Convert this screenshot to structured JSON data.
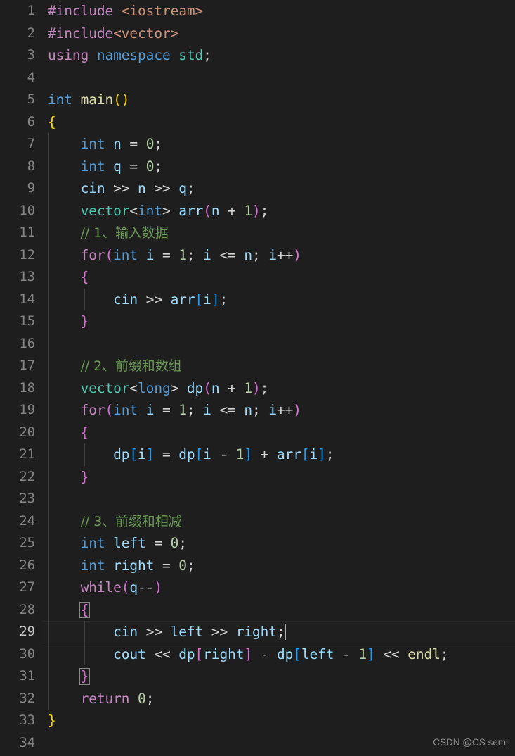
{
  "editor": {
    "language": "cpp",
    "theme": "dark-plus",
    "background_color": "#1e1e1e",
    "gutter_color": "#858585",
    "active_line_number": 29,
    "total_lines": 34,
    "cursor": {
      "line": 29,
      "column": 25
    }
  },
  "watermark": {
    "text": "CSDN @CS semi"
  },
  "line_numbers": [
    "1",
    "2",
    "3",
    "4",
    "5",
    "6",
    "7",
    "8",
    "9",
    "10",
    "11",
    "12",
    "13",
    "14",
    "15",
    "16",
    "17",
    "18",
    "19",
    "20",
    "21",
    "22",
    "23",
    "24",
    "25",
    "26",
    "27",
    "28",
    "29",
    "30",
    "31",
    "32",
    "33",
    "34"
  ],
  "code": {
    "full_text": "#include <iostream>\n#include<vector>\nusing namespace std;\n\nint main()\n{\n    int n = 0;\n    int q = 0;\n    cin >> n >> q;\n    vector<int> arr(n + 1);\n    // 1、输入数据\n    for(int i = 1; i <= n; i++)\n    {\n        cin >> arr[i];\n    }\n\n    // 2、前缀和数组\n    vector<long> dp(n + 1);\n    for(int i = 1; i <= n; i++)\n    {\n        dp[i] = dp[i - 1] + arr[i];\n    }\n\n    // 3、前缀和相减\n    int left = 0;\n    int right = 0;\n    while(q--)\n    {\n        cin >> left >> right;\n        cout << dp[right] - dp[left - 1] << endl;\n    }\n    return 0;\n}\n",
    "lines": [
      {
        "n": "1",
        "text": "#include <iostream>"
      },
      {
        "n": "2",
        "text": "#include<vector>"
      },
      {
        "n": "3",
        "text": "using namespace std;"
      },
      {
        "n": "4",
        "text": ""
      },
      {
        "n": "5",
        "text": "int main()"
      },
      {
        "n": "6",
        "text": "{"
      },
      {
        "n": "7",
        "text": "    int n = 0;"
      },
      {
        "n": "8",
        "text": "    int q = 0;"
      },
      {
        "n": "9",
        "text": "    cin >> n >> q;"
      },
      {
        "n": "10",
        "text": "    vector<int> arr(n + 1);"
      },
      {
        "n": "11",
        "text": "    // 1、输入数据"
      },
      {
        "n": "12",
        "text": "    for(int i = 1; i <= n; i++)"
      },
      {
        "n": "13",
        "text": "    {"
      },
      {
        "n": "14",
        "text": "        cin >> arr[i];"
      },
      {
        "n": "15",
        "text": "    }"
      },
      {
        "n": "16",
        "text": ""
      },
      {
        "n": "17",
        "text": "    // 2、前缀和数组"
      },
      {
        "n": "18",
        "text": "    vector<long> dp(n + 1);"
      },
      {
        "n": "19",
        "text": "    for(int i = 1; i <= n; i++)"
      },
      {
        "n": "20",
        "text": "    {"
      },
      {
        "n": "21",
        "text": "        dp[i] = dp[i - 1] + arr[i];"
      },
      {
        "n": "22",
        "text": "    }"
      },
      {
        "n": "23",
        "text": ""
      },
      {
        "n": "24",
        "text": "    // 3、前缀和相减"
      },
      {
        "n": "25",
        "text": "    int left = 0;"
      },
      {
        "n": "26",
        "text": "    int right = 0;"
      },
      {
        "n": "27",
        "text": "    while(q--)"
      },
      {
        "n": "28",
        "text": "    {"
      },
      {
        "n": "29",
        "text": "        cin >> left >> right;"
      },
      {
        "n": "30",
        "text": "        cout << dp[right] - dp[left - 1] << endl;"
      },
      {
        "n": "31",
        "text": "    }"
      },
      {
        "n": "32",
        "text": "    return 0;"
      },
      {
        "n": "33",
        "text": "}"
      },
      {
        "n": "34",
        "text": ""
      }
    ]
  },
  "tokens": {
    "l1": [
      [
        "#include",
        "t-control"
      ],
      [
        " ",
        "t-default"
      ],
      [
        "<iostream>",
        "t-string"
      ]
    ],
    "l2": [
      [
        "#include",
        "t-control"
      ],
      [
        "<vector>",
        "t-string"
      ]
    ],
    "l3": [
      [
        "using",
        "t-control"
      ],
      [
        " ",
        "t-default"
      ],
      [
        "namespace",
        "t-keyword"
      ],
      [
        " ",
        "t-default"
      ],
      [
        "std",
        "t-type"
      ],
      [
        ";",
        "t-default"
      ]
    ],
    "l4": [],
    "l5": [
      [
        "int",
        "t-keyword"
      ],
      [
        " ",
        "t-default"
      ],
      [
        "main",
        "t-function"
      ],
      [
        "(",
        ">br1"
      ],
      [
        ")",
        ">br1"
      ]
    ],
    "l6": [
      [
        "{",
        "t-br1"
      ]
    ],
    "l7": [
      [
        "int",
        "t-keyword"
      ],
      [
        " ",
        "t-default"
      ],
      [
        "n",
        "t-var"
      ],
      [
        " = ",
        "t-default"
      ],
      [
        "0",
        "t-number"
      ],
      [
        ";",
        "t-default"
      ]
    ],
    "l8": [
      [
        "int",
        "t-keyword"
      ],
      [
        " ",
        "t-default"
      ],
      [
        "q",
        "t-var"
      ],
      [
        " = ",
        "t-default"
      ],
      [
        "0",
        "t-number"
      ],
      [
        ";",
        "t-default"
      ]
    ],
    "l9": [
      [
        "cin",
        "t-var"
      ],
      [
        " >> ",
        "t-default"
      ],
      [
        "n",
        "t-var"
      ],
      [
        " >> ",
        "t-default"
      ],
      [
        "q",
        "t-var"
      ],
      [
        ";",
        "t-default"
      ]
    ],
    "l10": [
      [
        "vector",
        "t-type"
      ],
      [
        "<",
        "t-default"
      ],
      [
        "int",
        "t-keyword"
      ],
      [
        "> ",
        "t-default"
      ],
      [
        "arr",
        "t-var"
      ],
      [
        "(",
        "t-br2"
      ],
      [
        "n",
        "t-var"
      ],
      [
        " + ",
        "t-default"
      ],
      [
        "1",
        "t-number"
      ],
      [
        ")",
        "t-br2"
      ],
      [
        ";",
        "t-default"
      ]
    ],
    "l11": [
      [
        "// 1、输入数据",
        "t-comment"
      ]
    ],
    "l12": [
      [
        "for",
        "t-control"
      ],
      [
        "(",
        "t-br2"
      ],
      [
        "int",
        "t-keyword"
      ],
      [
        " ",
        "t-default"
      ],
      [
        "i",
        "t-var"
      ],
      [
        " = ",
        "t-default"
      ],
      [
        "1",
        "t-number"
      ],
      [
        "; ",
        "t-default"
      ],
      [
        "i",
        "t-var"
      ],
      [
        " <= ",
        "t-default"
      ],
      [
        "n",
        "t-var"
      ],
      [
        "; ",
        "t-default"
      ],
      [
        "i",
        "t-var"
      ],
      [
        "++",
        "t-default"
      ],
      [
        ")",
        "t-br2"
      ]
    ],
    "l13": [
      [
        "{",
        "t-br2"
      ]
    ],
    "l14": [
      [
        "cin",
        "t-var"
      ],
      [
        " >> ",
        "t-default"
      ],
      [
        "arr",
        "t-var"
      ],
      [
        "[",
        "t-br3"
      ],
      [
        "i",
        "t-var"
      ],
      [
        "]",
        "t-br3"
      ],
      [
        ";",
        "t-default"
      ]
    ],
    "l15": [
      [
        "}",
        "t-br2"
      ]
    ],
    "l16": [],
    "l17": [
      [
        "// 2、前缀和数组",
        "t-comment"
      ]
    ],
    "l18": [
      [
        "vector",
        "t-type"
      ],
      [
        "<",
        "t-default"
      ],
      [
        "long",
        "t-keyword"
      ],
      [
        "> ",
        "t-default"
      ],
      [
        "dp",
        "t-var"
      ],
      [
        "(",
        "t-br2"
      ],
      [
        "n",
        "t-var"
      ],
      [
        " + ",
        "t-default"
      ],
      [
        "1",
        "t-number"
      ],
      [
        ")",
        "t-br2"
      ],
      [
        ";",
        "t-default"
      ]
    ],
    "l19": [
      [
        "for",
        "t-control"
      ],
      [
        "(",
        "t-br2"
      ],
      [
        "int",
        "t-keyword"
      ],
      [
        " ",
        "t-default"
      ],
      [
        "i",
        "t-var"
      ],
      [
        " = ",
        "t-default"
      ],
      [
        "1",
        "t-number"
      ],
      [
        "; ",
        "t-default"
      ],
      [
        "i",
        "t-var"
      ],
      [
        " <= ",
        "t-default"
      ],
      [
        "n",
        "t-var"
      ],
      [
        "; ",
        "t-default"
      ],
      [
        "i",
        "t-var"
      ],
      [
        "++",
        "t-default"
      ],
      [
        ")",
        "t-br2"
      ]
    ],
    "l20": [
      [
        "{",
        "t-br2"
      ]
    ],
    "l21": [
      [
        "dp",
        "t-var"
      ],
      [
        "[",
        "t-br3"
      ],
      [
        "i",
        "t-var"
      ],
      [
        "]",
        "t-br3"
      ],
      [
        " = ",
        "t-default"
      ],
      [
        "dp",
        "t-var"
      ],
      [
        "[",
        "t-br3"
      ],
      [
        "i",
        "t-var"
      ],
      [
        " - ",
        "t-default"
      ],
      [
        "1",
        "t-number"
      ],
      [
        "]",
        "t-br3"
      ],
      [
        " + ",
        "t-default"
      ],
      [
        "arr",
        "t-var"
      ],
      [
        "[",
        "t-br3"
      ],
      [
        "i",
        "t-var"
      ],
      [
        "]",
        "t-br3"
      ],
      [
        ";",
        "t-default"
      ]
    ],
    "l22": [
      [
        "}",
        "t-br2"
      ]
    ],
    "l23": [],
    "l24": [
      [
        "// 3、前缀和相减",
        "t-comment"
      ]
    ],
    "l25": [
      [
        "int",
        "t-keyword"
      ],
      [
        " ",
        "t-default"
      ],
      [
        "left",
        "t-var"
      ],
      [
        " = ",
        "t-default"
      ],
      [
        "0",
        "t-number"
      ],
      [
        ";",
        "t-default"
      ]
    ],
    "l26": [
      [
        "int",
        "t-keyword"
      ],
      [
        " ",
        "t-default"
      ],
      [
        "right",
        "t-var"
      ],
      [
        " = ",
        "t-default"
      ],
      [
        "0",
        "t-number"
      ],
      [
        ";",
        "t-default"
      ]
    ],
    "l27": [
      [
        "while",
        "t-control"
      ],
      [
        "(",
        "t-br2"
      ],
      [
        "q",
        "t-var"
      ],
      [
        "--",
        "t-default"
      ],
      [
        ")",
        "t-br2"
      ]
    ],
    "l28": [
      [
        "{",
        "t-br2"
      ]
    ],
    "l29": [
      [
        "cin",
        "t-var"
      ],
      [
        " >> ",
        "t-default"
      ],
      [
        "left",
        "t-var"
      ],
      [
        " >> ",
        "t-default"
      ],
      [
        "right",
        "t-var"
      ],
      [
        ";",
        "t-default"
      ]
    ],
    "l30": [
      [
        "cout",
        "t-var"
      ],
      [
        " << ",
        "t-default"
      ],
      [
        "dp",
        "t-var"
      ],
      [
        "[",
        "t-br2"
      ],
      [
        "right",
        "t-var"
      ],
      [
        "]",
        "t-br2"
      ],
      [
        " - ",
        "t-default"
      ],
      [
        "dp",
        "t-var"
      ],
      [
        "[",
        "t-br3"
      ],
      [
        "left",
        "t-var"
      ],
      [
        " - ",
        "t-default"
      ],
      [
        "1",
        "t-number"
      ],
      [
        "]",
        "t-br3"
      ],
      [
        " << ",
        "t-default"
      ],
      [
        "endl",
        "t-function"
      ],
      [
        ";",
        "t-default"
      ]
    ],
    "l31": [
      [
        "}",
        "t-br2"
      ]
    ],
    "l32": [
      [
        "return",
        "t-control"
      ],
      [
        " ",
        "t-default"
      ],
      [
        "0",
        "t-number"
      ],
      [
        ";",
        "t-default"
      ]
    ],
    "l33": [
      [
        "}",
        "t-br1"
      ]
    ],
    "l34": []
  },
  "colors": {
    "background": "#1e1e1e",
    "foreground": "#d4d4d4",
    "line_number": "#858585",
    "line_number_active": "#c6c6c6",
    "keyword": "#569cd6",
    "control_keyword": "#c586c0",
    "type": "#4ec9b0",
    "variable": "#9cdcfe",
    "number": "#b5cea8",
    "comment": "#6a9955",
    "string": "#ce9178",
    "function": "#dcdcaa",
    "bracket_level_1": "#ffd700",
    "bracket_level_2": "#da70d6",
    "bracket_level_3": "#179fff",
    "indent_guide": "#404040",
    "cursor": "#aeafad",
    "watermark": "#a0a0a0"
  }
}
